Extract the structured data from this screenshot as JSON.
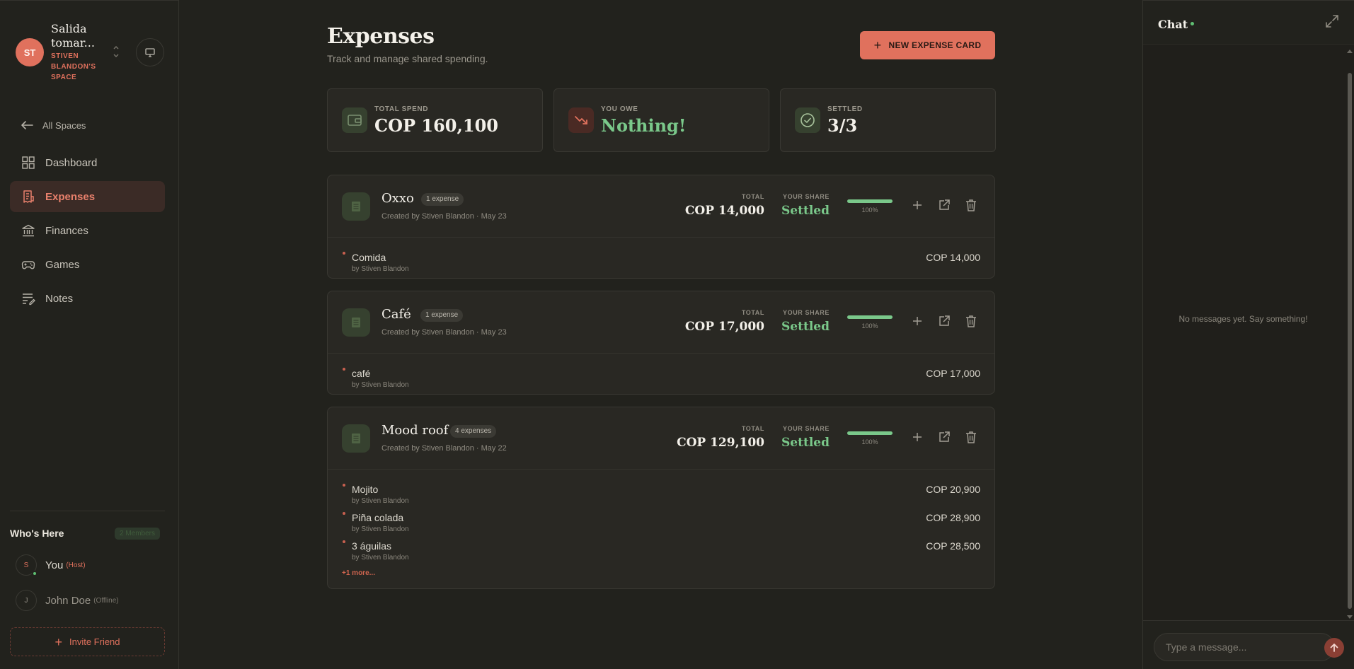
{
  "space": {
    "avatar": "ST",
    "title": "Salida tomar...",
    "subtitle": "STIVEN BLANDON'S SPACE"
  },
  "nav": {
    "back": "All Spaces",
    "items": [
      {
        "label": "Dashboard",
        "icon": "grid-icon"
      },
      {
        "label": "Expenses",
        "icon": "receipt-icon",
        "active": true
      },
      {
        "label": "Finances",
        "icon": "bank-icon"
      },
      {
        "label": "Games",
        "icon": "gamepad-icon"
      },
      {
        "label": "Notes",
        "icon": "notes-icon"
      }
    ]
  },
  "who": {
    "title": "Who's Here",
    "badge": "2 Members",
    "members": [
      {
        "avatar": "S",
        "name": "You",
        "tag": "(Host)",
        "online": true
      },
      {
        "avatar": "J",
        "name": "John Doe",
        "tag": "(Offline)",
        "online": false
      }
    ],
    "invite": "Invite Friend"
  },
  "page": {
    "title": "Expenses",
    "subtitle": "Track and manage shared spending.",
    "new_button": "NEW EXPENSE CARD"
  },
  "stats": [
    {
      "label": "TOTAL SPEND",
      "value": "COP 160,100",
      "icon": "wallet-icon"
    },
    {
      "label": "YOU OWE",
      "value": "Nothing!",
      "icon": "trend-down-icon"
    },
    {
      "label": "SETTLED",
      "value": "3/3",
      "icon": "check-circle-icon"
    }
  ],
  "labels": {
    "total": "TOTAL",
    "your_share": "YOUR SHARE"
  },
  "cards": [
    {
      "name": "Oxxo",
      "badge": "1 expense",
      "meta": "Created by Stiven Blandon · May 23",
      "total": "COP 14,000",
      "share": "Settled",
      "progress": 1.0,
      "progress_label": "100%",
      "items": [
        {
          "name": "Comida",
          "by": "by Stiven Blandon",
          "amount": "COP 14,000"
        }
      ]
    },
    {
      "name": "Café",
      "badge": "1 expense",
      "meta": "Created by Stiven Blandon · May 23",
      "total": "COP 17,000",
      "share": "Settled",
      "progress": 1.0,
      "progress_label": "100%",
      "items": [
        {
          "name": "café",
          "by": "by Stiven Blandon",
          "amount": "COP 17,000"
        }
      ]
    },
    {
      "name": "Mood roof",
      "badge": "4 expenses",
      "meta": "Created by Stiven Blandon · May 22",
      "total": "COP 129,100",
      "share": "Settled",
      "progress": 1.0,
      "progress_label": "100%",
      "items": [
        {
          "name": "Mojito",
          "by": "by Stiven Blandon",
          "amount": "COP 20,900"
        },
        {
          "name": "Piña colada",
          "by": "by Stiven Blandon",
          "amount": "COP 28,900"
        },
        {
          "name": "3 águilas",
          "by": "by Stiven Blandon",
          "amount": "COP 28,500"
        }
      ],
      "more": "+1 more..."
    }
  ],
  "chat": {
    "title": "Chat",
    "empty": "No messages yet. Say something!",
    "placeholder": "Type a message..."
  },
  "colors": {
    "accent": "#e0715d",
    "success": "#7ac88a",
    "background": "#22221d",
    "card": "#292823"
  }
}
